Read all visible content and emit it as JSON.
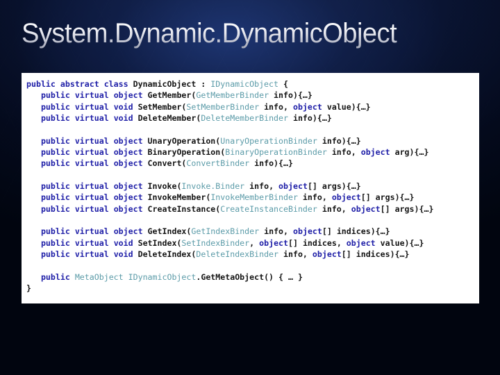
{
  "slide": {
    "title": "System.Dynamic.DynamicObject",
    "background_color": "#0b1636",
    "panel_color": "#ffffff"
  },
  "code": {
    "language": "csharp",
    "colors": {
      "keyword": "#2020a8",
      "type": "#5b9ba8",
      "plain": "#141414"
    },
    "lines": [
      [
        {
          "t": "public",
          "c": "kw"
        },
        {
          "t": " ",
          "c": "pl"
        },
        {
          "t": "abstract",
          "c": "kw"
        },
        {
          "t": " ",
          "c": "pl"
        },
        {
          "t": "class",
          "c": "kw"
        },
        {
          "t": " DynamicObject : ",
          "c": "pl"
        },
        {
          "t": "IDynamicObject",
          "c": "ty"
        },
        {
          "t": " {",
          "c": "pl"
        }
      ],
      [
        {
          "t": "   ",
          "c": "pl"
        },
        {
          "t": "public",
          "c": "kw"
        },
        {
          "t": " ",
          "c": "pl"
        },
        {
          "t": "virtual",
          "c": "kw"
        },
        {
          "t": " ",
          "c": "pl"
        },
        {
          "t": "object",
          "c": "kw"
        },
        {
          "t": " GetMember(",
          "c": "pl"
        },
        {
          "t": "GetMemberBinder",
          "c": "ty"
        },
        {
          "t": " info){…}",
          "c": "pl"
        }
      ],
      [
        {
          "t": "   ",
          "c": "pl"
        },
        {
          "t": "public",
          "c": "kw"
        },
        {
          "t": " ",
          "c": "pl"
        },
        {
          "t": "virtual",
          "c": "kw"
        },
        {
          "t": " ",
          "c": "pl"
        },
        {
          "t": "void",
          "c": "kw"
        },
        {
          "t": " SetMember(",
          "c": "pl"
        },
        {
          "t": "SetMemberBinder",
          "c": "ty"
        },
        {
          "t": " info, ",
          "c": "pl"
        },
        {
          "t": "object",
          "c": "kw"
        },
        {
          "t": " value){…}",
          "c": "pl"
        }
      ],
      [
        {
          "t": "   ",
          "c": "pl"
        },
        {
          "t": "public",
          "c": "kw"
        },
        {
          "t": " ",
          "c": "pl"
        },
        {
          "t": "virtual",
          "c": "kw"
        },
        {
          "t": " ",
          "c": "pl"
        },
        {
          "t": "void",
          "c": "kw"
        },
        {
          "t": " DeleteMember(",
          "c": "pl"
        },
        {
          "t": "DeleteMemberBinder",
          "c": "ty"
        },
        {
          "t": " info){…}",
          "c": "pl"
        }
      ],
      [],
      [
        {
          "t": "   ",
          "c": "pl"
        },
        {
          "t": "public",
          "c": "kw"
        },
        {
          "t": " ",
          "c": "pl"
        },
        {
          "t": "virtual",
          "c": "kw"
        },
        {
          "t": " ",
          "c": "pl"
        },
        {
          "t": "object",
          "c": "kw"
        },
        {
          "t": " UnaryOperation(",
          "c": "pl"
        },
        {
          "t": "UnaryOperationBinder",
          "c": "ty"
        },
        {
          "t": " info){…}",
          "c": "pl"
        }
      ],
      [
        {
          "t": "   ",
          "c": "pl"
        },
        {
          "t": "public",
          "c": "kw"
        },
        {
          "t": " ",
          "c": "pl"
        },
        {
          "t": "virtual",
          "c": "kw"
        },
        {
          "t": " ",
          "c": "pl"
        },
        {
          "t": "object",
          "c": "kw"
        },
        {
          "t": " BinaryOperation(",
          "c": "pl"
        },
        {
          "t": "BinaryOperationBinder",
          "c": "ty"
        },
        {
          "t": " info, ",
          "c": "pl"
        },
        {
          "t": "object",
          "c": "kw"
        },
        {
          "t": " arg){…}",
          "c": "pl"
        }
      ],
      [
        {
          "t": "   ",
          "c": "pl"
        },
        {
          "t": "public",
          "c": "kw"
        },
        {
          "t": " ",
          "c": "pl"
        },
        {
          "t": "virtual",
          "c": "kw"
        },
        {
          "t": " ",
          "c": "pl"
        },
        {
          "t": "object",
          "c": "kw"
        },
        {
          "t": " Convert(",
          "c": "pl"
        },
        {
          "t": "ConvertBinder",
          "c": "ty"
        },
        {
          "t": " info){…}",
          "c": "pl"
        }
      ],
      [],
      [
        {
          "t": "   ",
          "c": "pl"
        },
        {
          "t": "public",
          "c": "kw"
        },
        {
          "t": " ",
          "c": "pl"
        },
        {
          "t": "virtual",
          "c": "kw"
        },
        {
          "t": " ",
          "c": "pl"
        },
        {
          "t": "object",
          "c": "kw"
        },
        {
          "t": " Invoke(",
          "c": "pl"
        },
        {
          "t": "Invoke.Binder",
          "c": "ty"
        },
        {
          "t": " info, ",
          "c": "pl"
        },
        {
          "t": "object",
          "c": "kw"
        },
        {
          "t": "[] args){…}",
          "c": "pl"
        }
      ],
      [
        {
          "t": "   ",
          "c": "pl"
        },
        {
          "t": "public",
          "c": "kw"
        },
        {
          "t": " ",
          "c": "pl"
        },
        {
          "t": "virtual",
          "c": "kw"
        },
        {
          "t": " ",
          "c": "pl"
        },
        {
          "t": "object",
          "c": "kw"
        },
        {
          "t": " InvokeMember(",
          "c": "pl"
        },
        {
          "t": "InvokeMemberBinder",
          "c": "ty"
        },
        {
          "t": " info, ",
          "c": "pl"
        },
        {
          "t": "object",
          "c": "kw"
        },
        {
          "t": "[] args){…}",
          "c": "pl"
        }
      ],
      [
        {
          "t": "   ",
          "c": "pl"
        },
        {
          "t": "public",
          "c": "kw"
        },
        {
          "t": " ",
          "c": "pl"
        },
        {
          "t": "virtual",
          "c": "kw"
        },
        {
          "t": " ",
          "c": "pl"
        },
        {
          "t": "object",
          "c": "kw"
        },
        {
          "t": " CreateInstance(",
          "c": "pl"
        },
        {
          "t": "CreateInstanceBinder",
          "c": "ty"
        },
        {
          "t": " info, ",
          "c": "pl"
        },
        {
          "t": "object",
          "c": "kw"
        },
        {
          "t": "[] args){…}",
          "c": "pl"
        }
      ],
      [],
      [
        {
          "t": "   ",
          "c": "pl"
        },
        {
          "t": "public",
          "c": "kw"
        },
        {
          "t": " ",
          "c": "pl"
        },
        {
          "t": "virtual",
          "c": "kw"
        },
        {
          "t": " ",
          "c": "pl"
        },
        {
          "t": "object",
          "c": "kw"
        },
        {
          "t": " GetIndex(",
          "c": "pl"
        },
        {
          "t": "GetIndexBinder",
          "c": "ty"
        },
        {
          "t": " info, ",
          "c": "pl"
        },
        {
          "t": "object",
          "c": "kw"
        },
        {
          "t": "[] indices){…}",
          "c": "pl"
        }
      ],
      [
        {
          "t": "   ",
          "c": "pl"
        },
        {
          "t": "public",
          "c": "kw"
        },
        {
          "t": " ",
          "c": "pl"
        },
        {
          "t": "virtual",
          "c": "kw"
        },
        {
          "t": " ",
          "c": "pl"
        },
        {
          "t": "void",
          "c": "kw"
        },
        {
          "t": " SetIndex(",
          "c": "pl"
        },
        {
          "t": "SetIndexBinder",
          "c": "ty"
        },
        {
          "t": ", ",
          "c": "pl"
        },
        {
          "t": "object",
          "c": "kw"
        },
        {
          "t": "[] indices, ",
          "c": "pl"
        },
        {
          "t": "object",
          "c": "kw"
        },
        {
          "t": " value){…}",
          "c": "pl"
        }
      ],
      [
        {
          "t": "   ",
          "c": "pl"
        },
        {
          "t": "public",
          "c": "kw"
        },
        {
          "t": " ",
          "c": "pl"
        },
        {
          "t": "virtual",
          "c": "kw"
        },
        {
          "t": " ",
          "c": "pl"
        },
        {
          "t": "void",
          "c": "kw"
        },
        {
          "t": " DeleteIndex(",
          "c": "pl"
        },
        {
          "t": "DeleteIndexBinder",
          "c": "ty"
        },
        {
          "t": " info, ",
          "c": "pl"
        },
        {
          "t": "object",
          "c": "kw"
        },
        {
          "t": "[] indices){…}",
          "c": "pl"
        }
      ],
      [],
      [
        {
          "t": "   ",
          "c": "pl"
        },
        {
          "t": "public",
          "c": "kw"
        },
        {
          "t": " ",
          "c": "pl"
        },
        {
          "t": "MetaObject",
          "c": "ty"
        },
        {
          "t": " ",
          "c": "pl"
        },
        {
          "t": "IDynamicObject",
          "c": "ty"
        },
        {
          "t": ".GetMetaObject() { … }",
          "c": "pl"
        }
      ],
      [
        {
          "t": "}",
          "c": "pl"
        }
      ]
    ]
  }
}
